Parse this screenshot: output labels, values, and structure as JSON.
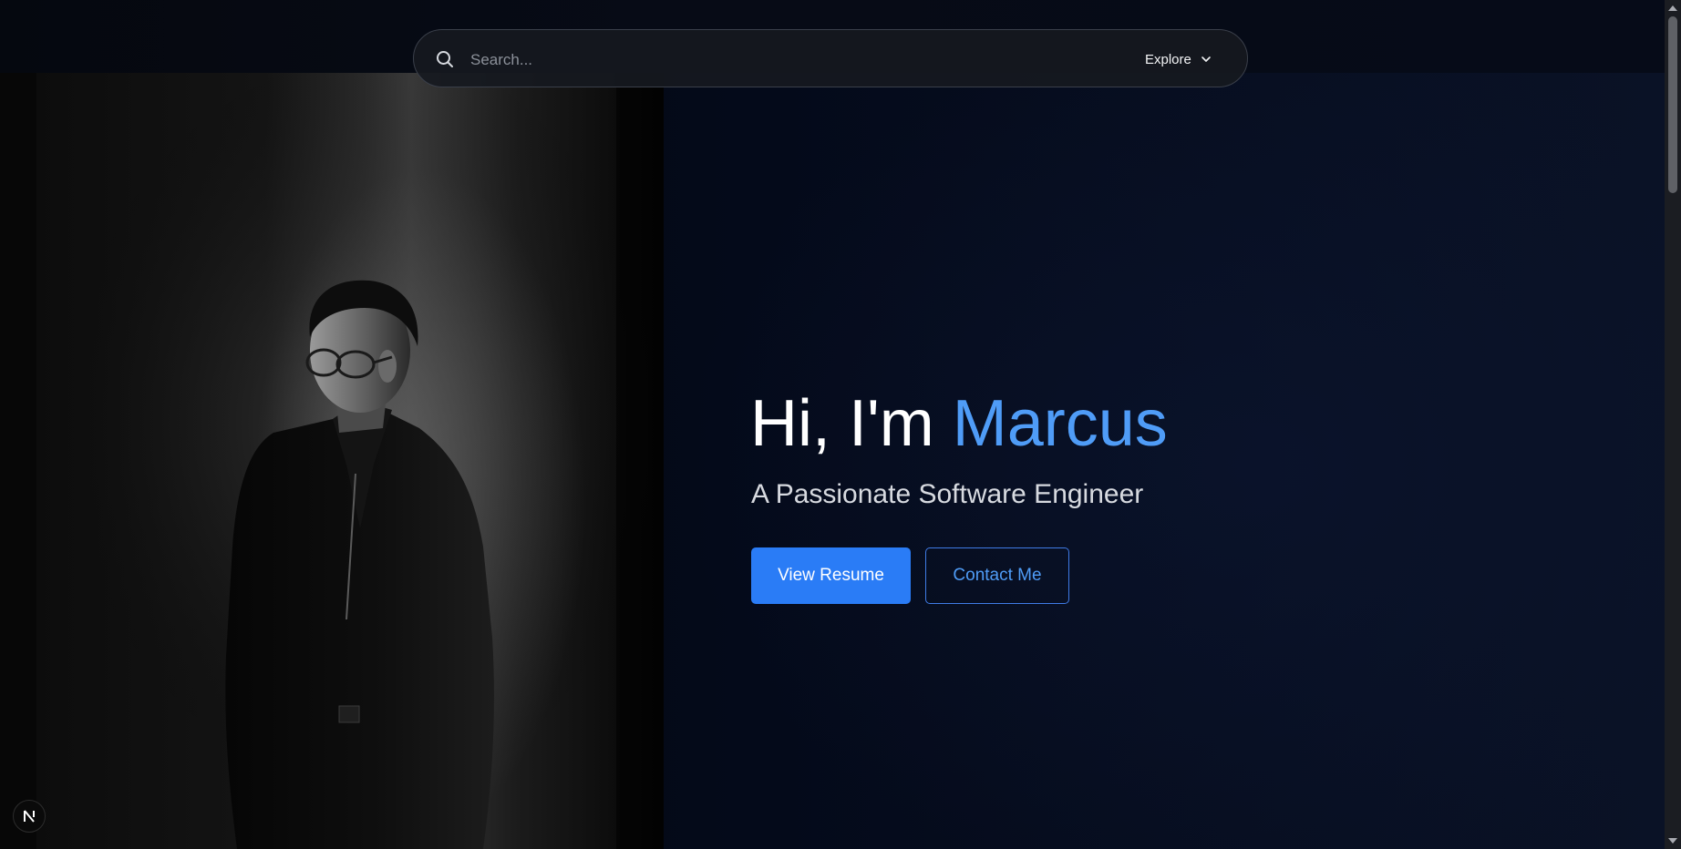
{
  "search": {
    "placeholder": "Search...",
    "value": "",
    "explore_label": "Explore"
  },
  "hero": {
    "greeting": "Hi, I'm ",
    "name": "Marcus",
    "subtitle": "A Passionate Software Engineer",
    "primary_button": "View Resume",
    "secondary_button": "Contact Me"
  },
  "badge": {
    "letter": "N"
  },
  "colors": {
    "accent": "#4f9cf7",
    "primary_button_bg": "#2a7cf6",
    "background": "#030814"
  },
  "icons": {
    "search": "search-icon",
    "explore_chevron": "chevron-down-icon",
    "badge": "nextjs-logo-icon"
  }
}
